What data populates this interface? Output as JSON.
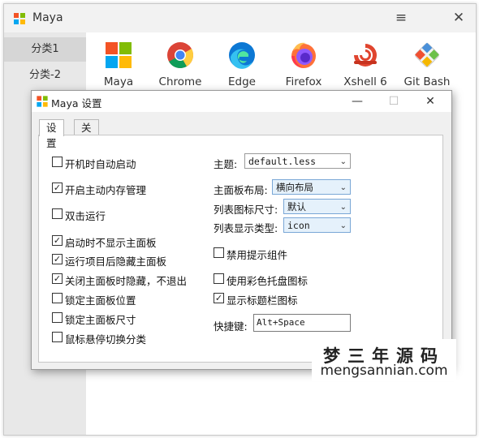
{
  "main_window": {
    "title": "Maya",
    "menu_icon": "hamburger-menu-icon",
    "close_icon": "close-icon"
  },
  "sidebar": {
    "items": [
      {
        "label": "分类1",
        "active": true
      },
      {
        "label": "分类-2",
        "active": false
      }
    ]
  },
  "apps": [
    {
      "label": "Maya",
      "icon": "windows-logo-icon"
    },
    {
      "label": "Chrome",
      "icon": "chrome-icon"
    },
    {
      "label": "Edge",
      "icon": "edge-icon"
    },
    {
      "label": "Firefox",
      "icon": "firefox-icon"
    },
    {
      "label": "Xshell 6",
      "icon": "xshell-icon"
    },
    {
      "label": "Git Bash",
      "icon": "git-bash-icon"
    }
  ],
  "dialog": {
    "title": "Maya 设置",
    "tabs": [
      {
        "label": "设置",
        "active": true
      },
      {
        "label": "关于",
        "active": false
      }
    ],
    "left_options": [
      {
        "label": "开机时自动启动",
        "checked": false
      },
      {
        "label": "开启主动内存管理",
        "checked": true
      },
      {
        "label": "双击运行",
        "checked": false
      },
      {
        "label": "启动时不显示主面板",
        "checked": true
      },
      {
        "label": "运行项目后隐藏主面板",
        "checked": true
      },
      {
        "label": "关闭主面板时隐藏，不退出",
        "checked": true
      },
      {
        "label": "锁定主面板位置",
        "checked": false
      },
      {
        "label": "锁定主面板尺寸",
        "checked": false
      },
      {
        "label": "鼠标悬停切换分类",
        "checked": false
      }
    ],
    "theme": {
      "label": "主题:",
      "value": "default.less"
    },
    "layout": {
      "label": "主面板布局:",
      "value": "横向布局"
    },
    "icon_size": {
      "label": "列表图标尺寸:",
      "value": "默认"
    },
    "display_type": {
      "label": "列表显示类型:",
      "value": "icon"
    },
    "right_options": [
      {
        "label": "禁用提示组件",
        "checked": false
      },
      {
        "label": "使用彩色托盘图标",
        "checked": false
      },
      {
        "label": "显示标题栏图标",
        "checked": true
      }
    ],
    "hotkey": {
      "label": "快捷键:",
      "value": "Alt+Space"
    }
  },
  "watermark": {
    "line1": "梦三年源码",
    "line2": "mengsannian.com"
  },
  "colors": {
    "accent": "#0078d7",
    "sidebar_bg": "#e8e8e8",
    "dialog_bg": "#f0f0f0"
  }
}
